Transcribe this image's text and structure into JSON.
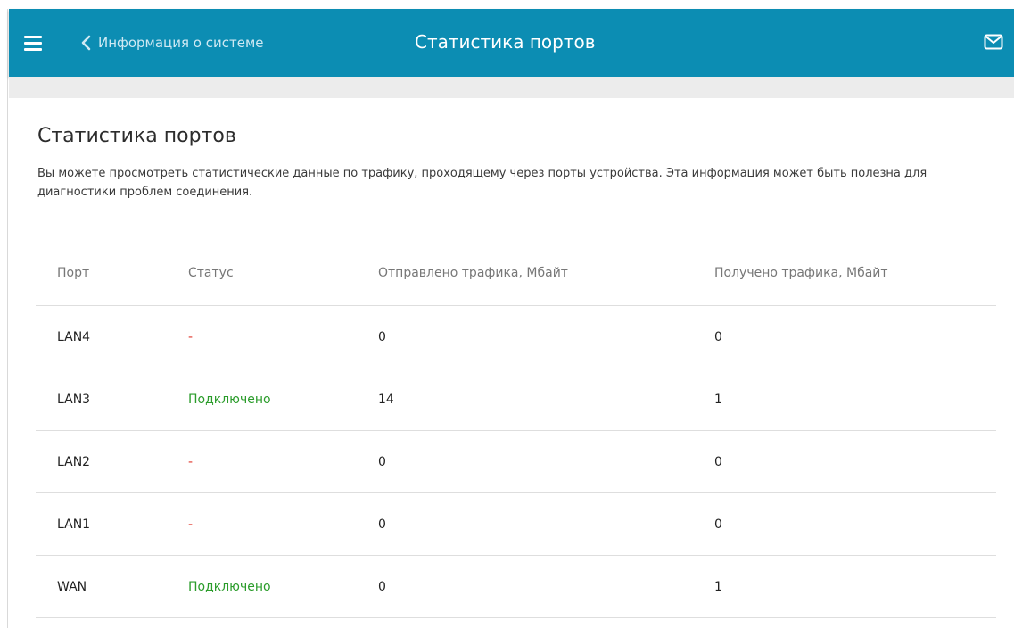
{
  "header": {
    "back_label": "Информация о системе",
    "title": "Статистика портов",
    "icons": {
      "menu": "menu-icon",
      "back": "chevron-left-icon",
      "mail": "mail-icon"
    },
    "background_color": "#0c8db3"
  },
  "page": {
    "title": "Статистика портов",
    "description": "Вы можете просмотреть статистические данные по трафику, проходящему через порты устройства. Эта информация может быть полезна для диагностики проблем соединения."
  },
  "table": {
    "columns": [
      "Порт",
      "Статус",
      "Отправлено трафика, Мбайт",
      "Получено трафика, Мбайт"
    ],
    "rows": [
      {
        "port": "LAN4",
        "status": "-",
        "sent": "0",
        "received": "0"
      },
      {
        "port": "LAN3",
        "status": "Подключено",
        "sent": "14",
        "received": "1"
      },
      {
        "port": "LAN2",
        "status": "-",
        "sent": "0",
        "received": "0"
      },
      {
        "port": "LAN1",
        "status": "-",
        "sent": "0",
        "received": "0"
      },
      {
        "port": "WAN",
        "status": "Подключено",
        "sent": "0",
        "received": "1"
      }
    ]
  },
  "colors": {
    "status_connected": "#2b9c2b",
    "status_disconnected": "#e03a2f"
  }
}
